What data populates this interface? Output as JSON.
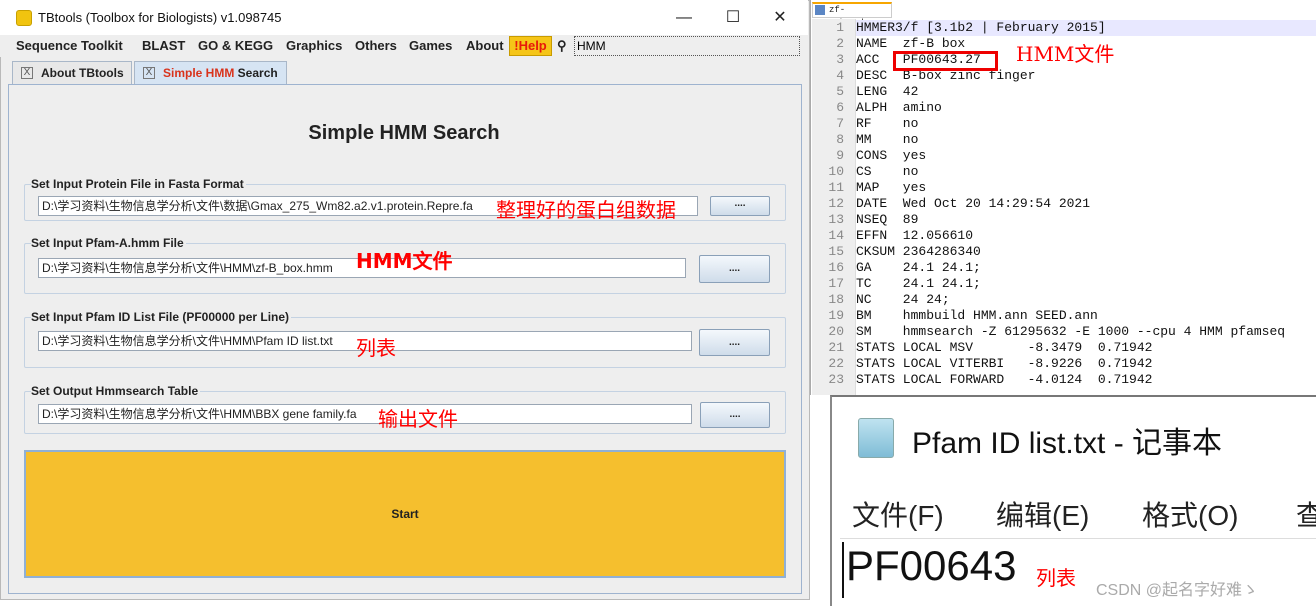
{
  "window": {
    "title": "TBtools (Toolbox for Biologists) v1.098745",
    "minimize": "—",
    "maximize": "☐",
    "close": "✕"
  },
  "menu": [
    "Sequence Toolkit",
    "BLAST",
    "GO & KEGG",
    "Graphics",
    "Others",
    "Games",
    "About"
  ],
  "help": "!Help",
  "search": {
    "value": "HMM",
    "icon": "magnifier-icon"
  },
  "tabs": [
    {
      "label": "About TBtools"
    },
    {
      "label_red": "Simple HMM",
      "label_rest": " Search"
    }
  ],
  "tab_close": "X",
  "heading": "Simple HMM Search",
  "groups": [
    {
      "label": "Set Input Protein File in Fasta Format",
      "value": "D:\\学习资料\\生物信息学分析\\文件\\数据\\Gmax_275_Wm82.a2.v1.protein.Repre.fa",
      "button": "....",
      "annotation": "整理好的蛋白组数据"
    },
    {
      "label": "Set Input Pfam-A.hmm File",
      "value": "D:\\学习资料\\生物信息学分析\\文件\\HMM\\zf-B_box.hmm",
      "button": "....",
      "annotation": "HMM文件"
    },
    {
      "label": "Set Input Pfam ID List File (PF00000 per Line)",
      "value": "D:\\学习资料\\生物信息学分析\\文件\\HMM\\Pfam ID list.txt",
      "button": "....",
      "annotation": "列表"
    },
    {
      "label": "Set Output Hmmsearch Table",
      "value": "D:\\学习资料\\生物信息学分析\\文件\\HMM\\BBX gene family.fa",
      "button": "....",
      "annotation": "输出文件"
    }
  ],
  "start": "Start",
  "editor": {
    "tab": "zf-B_box.hmm",
    "annotation": "HMM文件",
    "lines": [
      "HMMER3/f [3.1b2 | February 2015]",
      "NAME  zf-B box",
      "ACC   PF00643.27",
      "DESC  B-box zinc finger",
      "LENG  42",
      "ALPH  amino",
      "RF    no",
      "MM    no",
      "CONS  yes",
      "CS    no",
      "MAP   yes",
      "DATE  Wed Oct 20 14:29:54 2021",
      "NSEQ  89",
      "EFFN  12.056610",
      "CKSUM 2364286340",
      "GA    24.1 24.1;",
      "TC    24.1 24.1;",
      "NC    24 24;",
      "BM    hmmbuild HMM.ann SEED.ann",
      "SM    hmmsearch -Z 61295632 -E 1000 --cpu 4 HMM pfamseq",
      "STATS LOCAL MSV       -8.3479  0.71942",
      "STATS LOCAL VITERBI   -8.9226  0.71942",
      "STATS LOCAL FORWARD   -4.0124  0.71942"
    ]
  },
  "notepad": {
    "title": "Pfam ID list.txt - 记事本",
    "menu": [
      "文件(F)",
      "编辑(E)",
      "格式(O)",
      "查"
    ],
    "content": "PF00643",
    "annotation": "列表"
  },
  "watermark": "CSDN @起名字好难ゝ",
  "colors": {
    "start": "#f5bf2e",
    "help": "#f5c518",
    "annotation": "#ff0000"
  }
}
